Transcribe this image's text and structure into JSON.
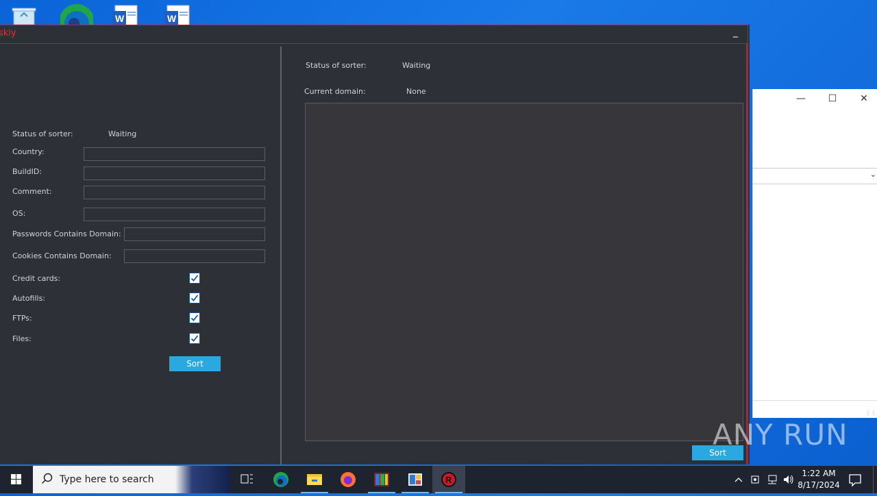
{
  "app": {
    "title": "skiy"
  },
  "left_panel": {
    "status_label": "Status of sorter:",
    "status_value": "Waiting",
    "fields": [
      {
        "label": "Country:",
        "value": ""
      },
      {
        "label": "BuildID:",
        "value": ""
      },
      {
        "label": "Comment:",
        "value": ""
      },
      {
        "label": "OS:",
        "value": ""
      },
      {
        "label": "Passwords Contains Domain:",
        "value": ""
      },
      {
        "label": "Cookies Contains Domain:",
        "value": ""
      }
    ],
    "checkboxes": [
      {
        "label": "Credit cards:",
        "checked": true
      },
      {
        "label": "Autofills:",
        "checked": true
      },
      {
        "label": "FTPs:",
        "checked": true
      },
      {
        "label": "Files:",
        "checked": true
      }
    ],
    "sort_button": "Sort"
  },
  "right_panel": {
    "status_label": "Status of sorter:",
    "status_value": "Waiting",
    "domain_label": "Current domain:",
    "domain_value": "None",
    "output_text": "",
    "sort_button": "Sort"
  },
  "watermark": "ANY RUN",
  "taskbar": {
    "search_placeholder": "Type here to search",
    "time": "1:22 AM",
    "date": "8/17/2024"
  },
  "colors": {
    "window_bg": "#2e3038",
    "accent_red": "#d0182a",
    "button_blue": "#2aa9e0",
    "taskbar": "#1d2430"
  }
}
